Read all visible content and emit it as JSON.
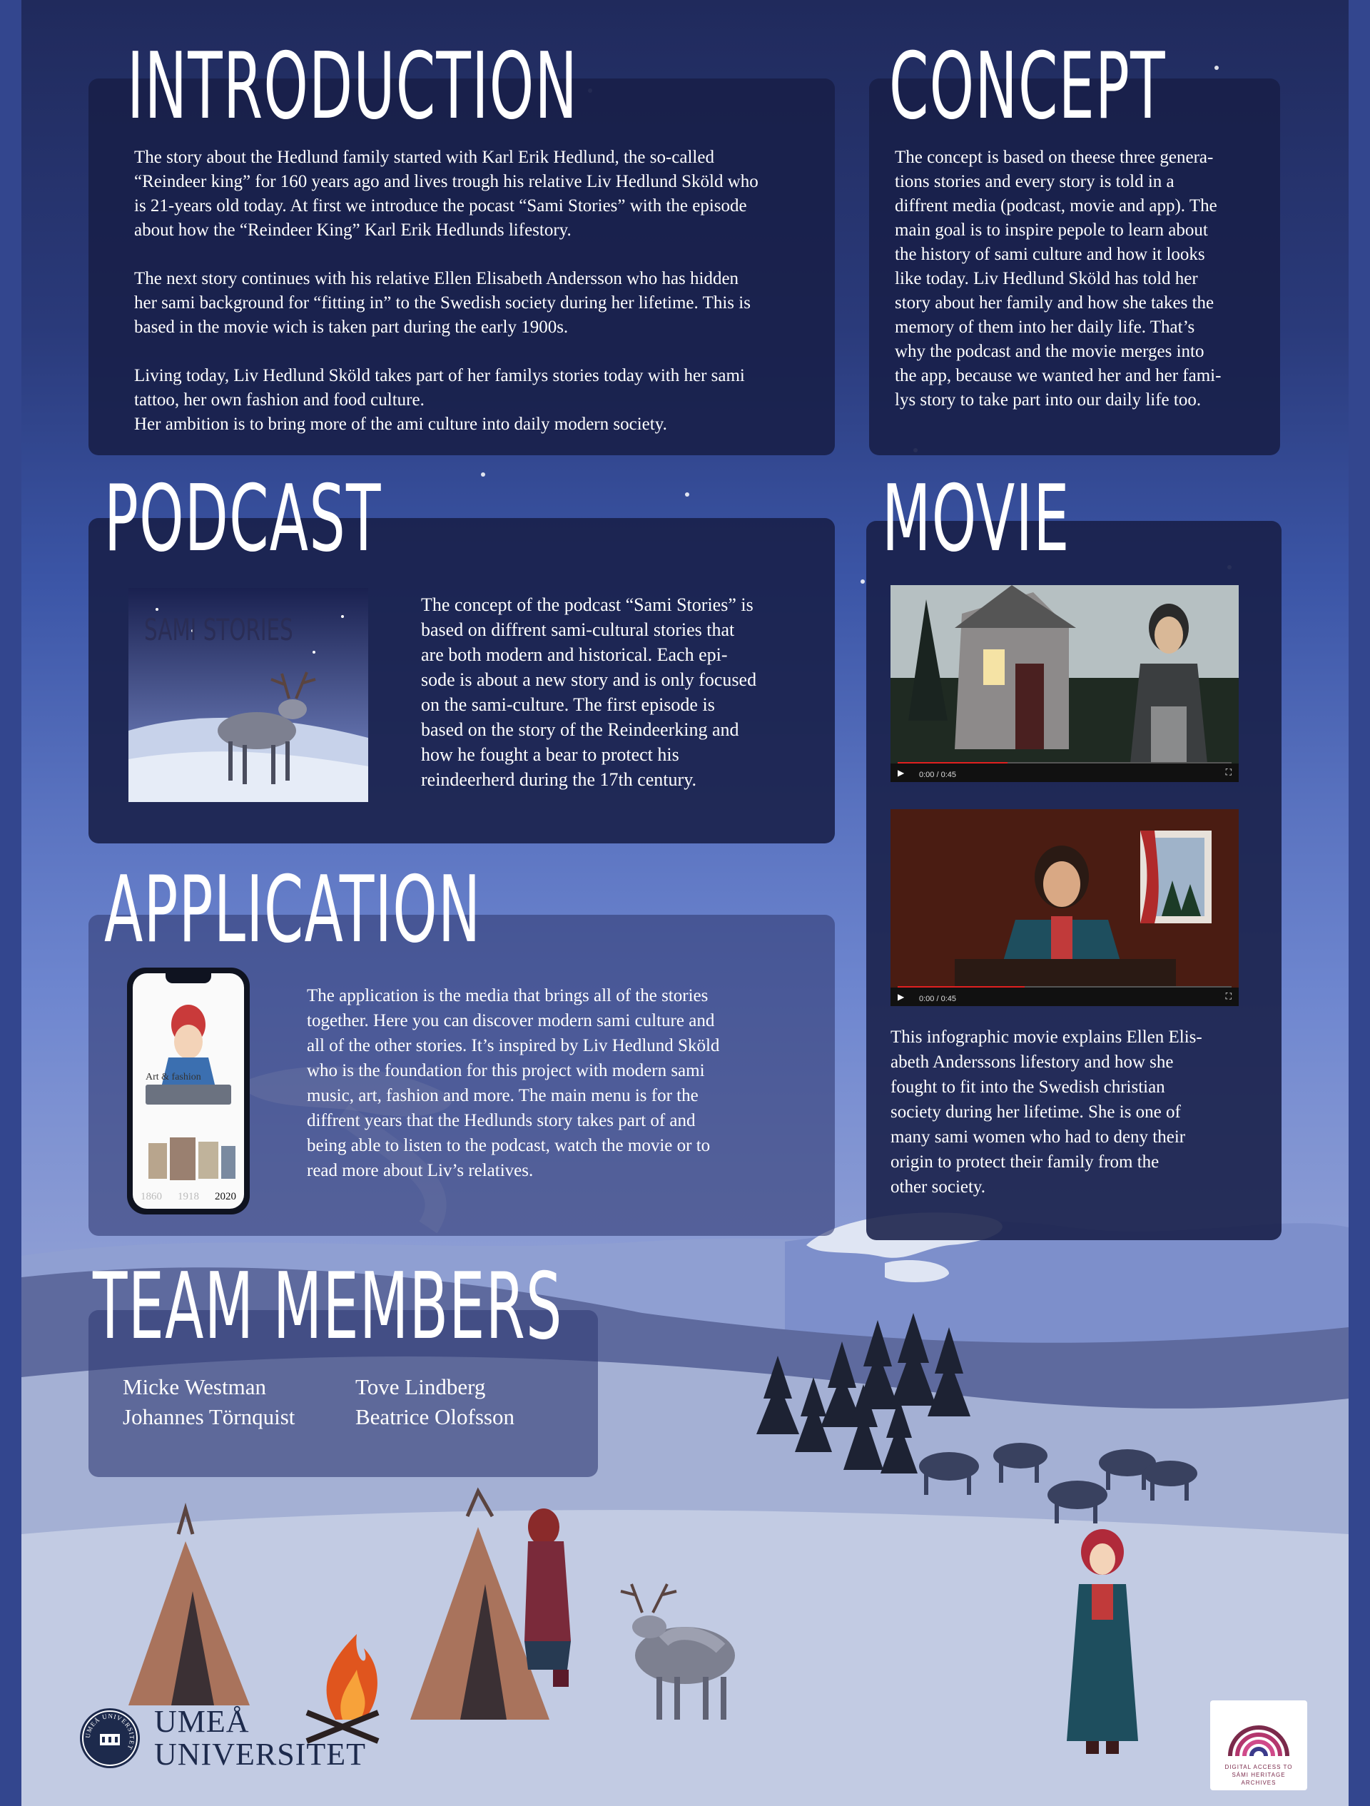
{
  "palette": {
    "panel": "#181f48",
    "accent_red": "#c93a3a",
    "snow": "#dfe5f3",
    "tent": "#a9735c"
  },
  "introduction": {
    "heading": "INTRODUCTION",
    "text": "The story about the Hedlund family started with Karl Erik Hedlund, the so-called\n“Reindeer king” for 160 years ago and lives trough his relative Liv Hedlund Sköld who\nis 21-years old today. At first we introduce the pocast “Sami Stories” with the episode\nabout how the “Reindeer King” Karl Erik Hedlunds lifestory.\n\nThe next story continues with his relative Ellen Elisabeth Andersson who has hidden\nher sami background for “fitting in” to the Swedish society during her lifetime. This is\nbased in the movie wich is taken part during the early 1900s.\n\nLiving today, Liv Hedlund Sköld takes part of her familys stories today with her sami\ntattoo, her own fashion and food culture.\nHer ambition is to bring more of the ami culture into daily modern society."
  },
  "concept": {
    "heading": "CONCEPT",
    "text": "The concept is based on theese three genera-\ntions stories and every story is told in a\ndiffrent media (podcast, movie and app). The\nmain goal is to inspire pepole to learn about\nthe history of sami culture and how it looks\nlike today. Liv Hedlund Sköld has told her\nstory about her family and how she takes the\nmemory of them into her daily life. That’s\nwhy the podcast and the movie merges into\nthe app, because we wanted her and her fami-\nlys story to take part into our daily life too."
  },
  "podcast": {
    "heading": "PODCAST",
    "cover_title": "SAMI STORIES",
    "text": "The concept of the podcast “Sami Stories” is\nbased on diffrent sami-cultural stories that\nare both modern and historical. Each epi-\nsode is about a new story and is only focused\non the sami-culture. The first episode is\nbased on the story of the Reindeerking and\nhow he fought a bear to protect his\nreindeerherd during the 17th century."
  },
  "movie": {
    "heading": "MOVIE",
    "video1": {
      "time": "0:00 / 0:45",
      "progress": 0.33
    },
    "video2": {
      "time": "0:00 / 0:45",
      "progress": 0.38
    },
    "text": "This infographic movie explains Ellen Elis-\nabeth Anderssons lifestory and how she\nfought to fit into the Swedish christian\nsociety during her lifetime. She is one of\nmany sami women who had to deny their\norigin to protect their family from the\nother society."
  },
  "application": {
    "heading": "APPLICATION",
    "phone_years": [
      "1860",
      "1918",
      "2020"
    ],
    "phone_label": "Art & fashion",
    "text": "The application is the media that brings all of the stories\ntogether. Here you can discover modern sami culture and\nall of the other stories. It’s inspired by Liv Hedlund Sköld\nwho is the foundation for this project with modern sami\nmusic, art, fashion and more. The main menu is for the\ndiffrent years that the Hedlunds story takes part of and\nbeing able to listen to the podcast, watch the movie or to\nread more about Liv’s relatives."
  },
  "team": {
    "heading": "TEAM MEMBERS",
    "members": [
      "Micke Westman",
      "Tove Lindberg",
      "Johannes Törnquist",
      "Beatrice Olofsson"
    ]
  },
  "logos": {
    "umea": "UMEÅ\nUNIVERSITET",
    "umea_seal": "UMEÅ UNIVERSITET",
    "sami": "DIGITAL ACCESS TO\nSÁMI HERITAGE\nARCHIVES"
  }
}
